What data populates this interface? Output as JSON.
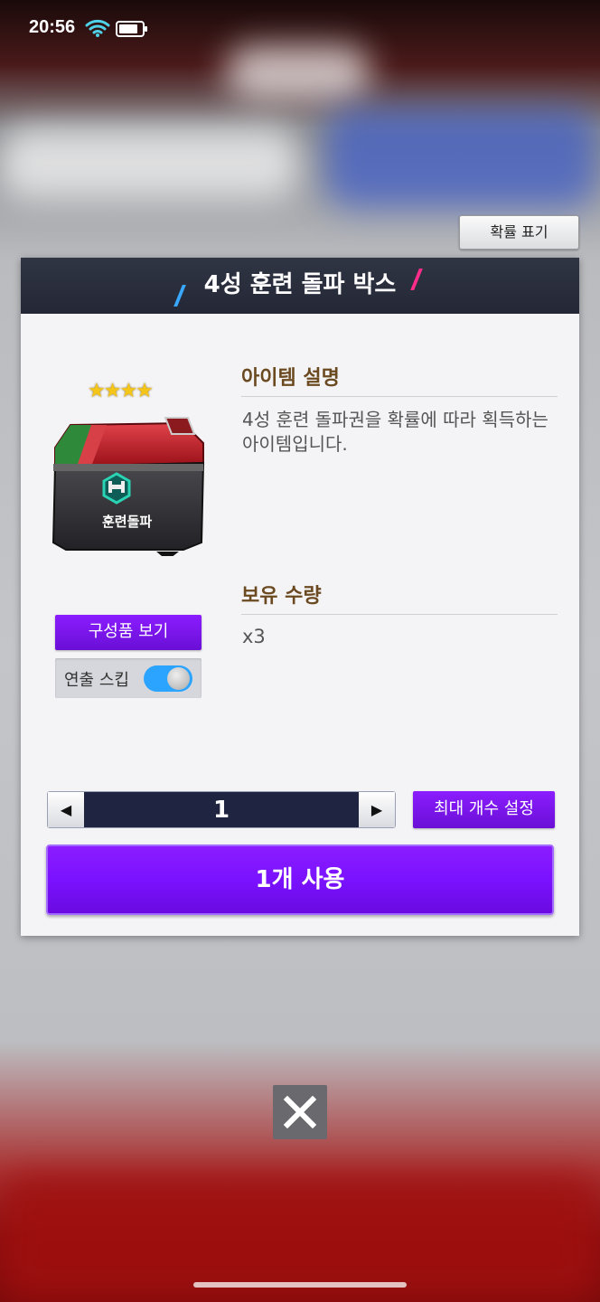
{
  "status_bar": {
    "time": "20:56",
    "wifi_icon": "wifi-icon",
    "battery_icon": "battery-icon"
  },
  "probability_button": {
    "label": "확률 표기"
  },
  "dialog": {
    "title": "4성 훈련 돌파 박스",
    "item": {
      "stars": "★★★★",
      "image_label": "훈련돌파",
      "icon": "treasure-chest-icon"
    },
    "description": {
      "title": "아이템 설명",
      "text": "4성 훈련 돌파권을 확률에 따라 획득하는 아이템입니다."
    },
    "owned": {
      "title": "보유 수량",
      "value": "x3"
    },
    "components_button": {
      "label": "구성품 보기"
    },
    "skip_animation": {
      "label": "연출 스킵",
      "enabled": true
    },
    "stepper": {
      "value": "1",
      "decrement_icon": "◀",
      "increment_icon": "▶"
    },
    "max_button": {
      "label": "최대 개수 설정"
    },
    "use_button": {
      "label": "1개 사용"
    }
  },
  "close_button": {
    "icon": "close-icon"
  },
  "colors": {
    "accent_purple": "#7a12ff",
    "header_dark": "#262a38",
    "toggle_blue": "#2ba4ff"
  }
}
